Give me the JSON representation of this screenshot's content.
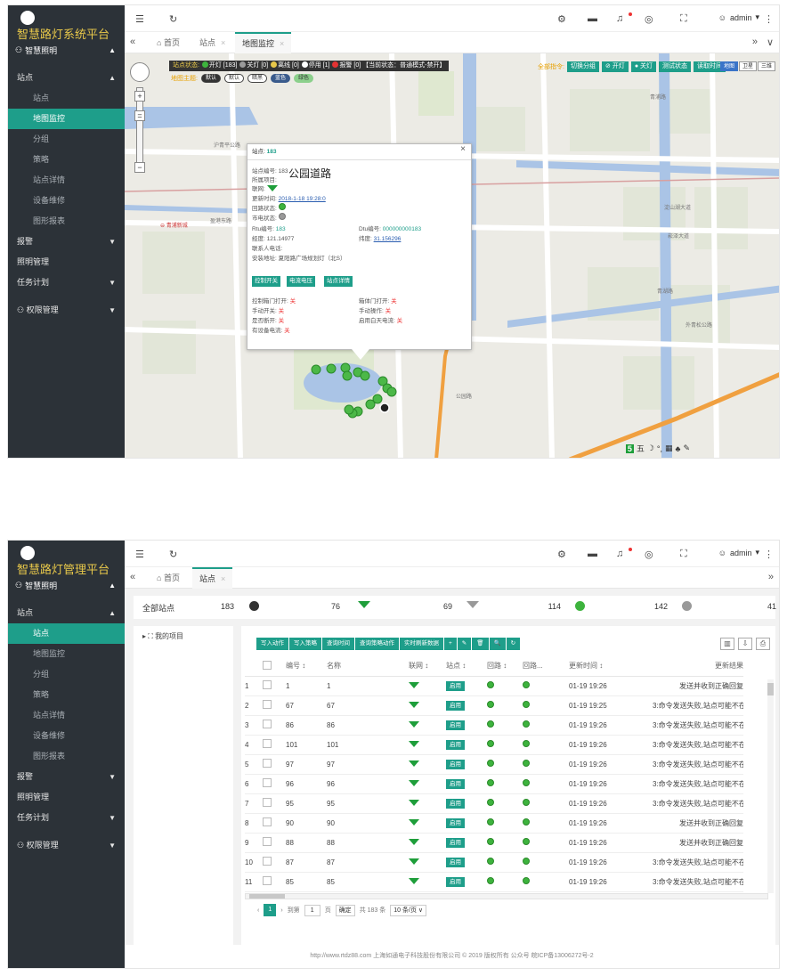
{
  "shot1": {
    "logo_title": "智慧路灯系统平台",
    "project_label": "智慧照明",
    "menu": [
      {
        "label": "站点",
        "type": "top",
        "caret": "▲"
      },
      {
        "label": "站点",
        "type": "sub"
      },
      {
        "label": "地图监控",
        "type": "sub",
        "active": true
      },
      {
        "label": "分组",
        "type": "sub"
      },
      {
        "label": "策略",
        "type": "sub"
      },
      {
        "label": "站点详情",
        "type": "sub"
      },
      {
        "label": "设备维修",
        "type": "sub"
      },
      {
        "label": "图形报表",
        "type": "sub"
      },
      {
        "label": "报警",
        "type": "top",
        "caret": "▼"
      },
      {
        "label": "照明管理",
        "type": "top"
      },
      {
        "label": "任务计划",
        "type": "top",
        "caret": "▼"
      },
      {
        "label": "权限管理",
        "type": "top",
        "caret": "▼"
      }
    ],
    "user": "admin",
    "tabs": [
      {
        "label": "首页",
        "icon": "home-icon"
      },
      {
        "label": "站点",
        "closable": true
      },
      {
        "label": "地图监控",
        "closable": true,
        "active": true
      }
    ],
    "legend": {
      "title": "站点状态:",
      "items": [
        {
          "label": "开灯 [183]",
          "color": "#3db33d"
        },
        {
          "label": "关灯 [0]",
          "color": "#9a9a9a"
        },
        {
          "label": "离线 [0]",
          "color": "#e8c84a"
        },
        {
          "label": "停用 [1]",
          "color": "#ffffff"
        },
        {
          "label": "报警 [0]",
          "color": "#e33333"
        }
      ],
      "tail": "【当前状态：普通模式-禁开】"
    },
    "theme": {
      "title": "地图主题:",
      "pills": [
        "默认",
        "默认",
        "暗黑",
        "蓝色",
        "绿色"
      ]
    },
    "commands": {
      "title": "全部指令:",
      "buttons": [
        "切换分组",
        "开灯",
        "关灯",
        "测试状态",
        "读取时间"
      ]
    },
    "map_types": [
      "地图",
      "卫星",
      "三维"
    ],
    "places": [
      "青浦路",
      "沪青平公路",
      "青浦新城",
      "盈港东路",
      "淀山湖大道",
      "公园路",
      "青湖路",
      "外青松公路",
      "崧泽大道"
    ],
    "popup": {
      "title_prefix": "站点:",
      "title_id": "183",
      "rows": [
        "站点编号:  183",
        "所属项目:",
        "联网:",
        "更新时间:",
        "回路状态:",
        "市电状态:"
      ],
      "project_name": "公园道路",
      "update_time": "2018-1-18 19:28:0",
      "rtu_label": "Rtu编号:",
      "rtu_value": "183",
      "dtu_label": "Dtu编号:",
      "dtu_value": "000000000183",
      "lng_label": "经度:",
      "lng_value": "121.14977",
      "lat_label": "纬度:",
      "lat_value": "31.156296",
      "contact_label": "联系人电话:",
      "address_label": "安装地址:",
      "address_value": "夏阳路广场规划灯（北S）",
      "buttons": [
        "控制开关",
        "电流电压",
        "站点详情"
      ],
      "status": [
        {
          "label": "控制箱门打开:",
          "value": "关"
        },
        {
          "label": "箱体门打开:",
          "value": "关"
        },
        {
          "label": "手动开关:",
          "value": "关"
        },
        {
          "label": "手动操作:",
          "value": "关"
        },
        {
          "label": "是否断开:",
          "value": "关"
        },
        {
          "label": "启用白天电流:",
          "value": "关"
        },
        {
          "label": "有设备电流:",
          "value": "关"
        }
      ]
    },
    "baidu": {
      "label": "五",
      "badge": "5"
    }
  },
  "shot2": {
    "logo_title": "智慧路灯管理平台",
    "project_label": "智慧照明",
    "menu": [
      {
        "label": "站点",
        "type": "top",
        "caret": "▲"
      },
      {
        "label": "站点",
        "type": "sub",
        "active": true
      },
      {
        "label": "地图监控",
        "type": "sub"
      },
      {
        "label": "分组",
        "type": "sub"
      },
      {
        "label": "策略",
        "type": "sub"
      },
      {
        "label": "站点详情",
        "type": "sub"
      },
      {
        "label": "设备维修",
        "type": "sub"
      },
      {
        "label": "图形报表",
        "type": "sub"
      },
      {
        "label": "报警",
        "type": "top",
        "caret": "▼"
      },
      {
        "label": "照明管理",
        "type": "top"
      },
      {
        "label": "任务计划",
        "type": "top",
        "caret": "▼"
      },
      {
        "label": "权限管理",
        "type": "top",
        "caret": "▼"
      }
    ],
    "user": "admin",
    "tabs": [
      {
        "label": "首页",
        "icon": "home-icon"
      },
      {
        "label": "站点",
        "closable": true,
        "active": true
      }
    ],
    "stats": {
      "all_label": "全部站点",
      "all_value": "183",
      "counts": [
        {
          "value": "76",
          "color": "#e33333"
        },
        {
          "value": "69",
          "color": "#3db33d"
        },
        {
          "value": "114",
          "color": "#555555"
        },
        {
          "value": "142",
          "color": "#3db33d"
        },
        {
          "value": "41",
          "color": "#3db33d"
        }
      ]
    },
    "tree": {
      "root": "我的项目"
    },
    "toolbar": [
      "写入动作",
      "写入策略",
      "查询时间",
      "查询策略动作",
      "实时刷新数据",
      "+",
      "✎",
      "🗑",
      "🔍",
      "↻"
    ],
    "columns": [
      "",
      "",
      "编号 ↕",
      "名称",
      "联网 ↕",
      "站点 ↕",
      "回路 ↕",
      "回路...",
      "更新时间 ↕",
      "更新结果"
    ],
    "rows": [
      {
        "idx": "1",
        "no": "1",
        "name": "1",
        "enabled": "启用",
        "time": "01-19 19:26",
        "result": "发送并收到正确回复"
      },
      {
        "idx": "2",
        "no": "67",
        "name": "67",
        "enabled": "启用",
        "time": "01-19 19:25",
        "result": "3:命令发送失败,站点可能不在线"
      },
      {
        "idx": "3",
        "no": "86",
        "name": "86",
        "enabled": "启用",
        "time": "01-19 19:26",
        "result": "3:命令发送失败,站点可能不在线"
      },
      {
        "idx": "4",
        "no": "101",
        "name": "101",
        "enabled": "启用",
        "time": "01-19 19:26",
        "result": "3:命令发送失败,站点可能不在线"
      },
      {
        "idx": "5",
        "no": "97",
        "name": "97",
        "enabled": "启用",
        "time": "01-19 19:26",
        "result": "3:命令发送失败,站点可能不在线"
      },
      {
        "idx": "6",
        "no": "96",
        "name": "96",
        "enabled": "启用",
        "time": "01-19 19:26",
        "result": "3:命令发送失败,站点可能不在线"
      },
      {
        "idx": "7",
        "no": "95",
        "name": "95",
        "enabled": "启用",
        "time": "01-19 19:26",
        "result": "3:命令发送失败,站点可能不在线"
      },
      {
        "idx": "8",
        "no": "90",
        "name": "90",
        "enabled": "启用",
        "time": "01-19 19:26",
        "result": "发送并收到正确回复"
      },
      {
        "idx": "9",
        "no": "88",
        "name": "88",
        "enabled": "启用",
        "time": "01-19 19:26",
        "result": "发送并收到正确回复"
      },
      {
        "idx": "10",
        "no": "87",
        "name": "87",
        "enabled": "启用",
        "time": "01-19 19:26",
        "result": "3:命令发送失败,站点可能不在线"
      },
      {
        "idx": "11",
        "no": "85",
        "name": "85",
        "enabled": "启用",
        "time": "01-19 19:26",
        "result": "3:命令发送失败,站点可能不在线"
      }
    ],
    "pager": {
      "page": "1",
      "goto_label": "到第",
      "goto_value": "1",
      "page_unit": "页",
      "confirm": "确定",
      "total": "共 183 条",
      "per_page": "10 条/页 ∨"
    },
    "footer": "http://www.rtdz88.com  上海如通电子科技股份有限公司 © 2019 版权所有    公众号   皖ICP备13006272号-2"
  }
}
